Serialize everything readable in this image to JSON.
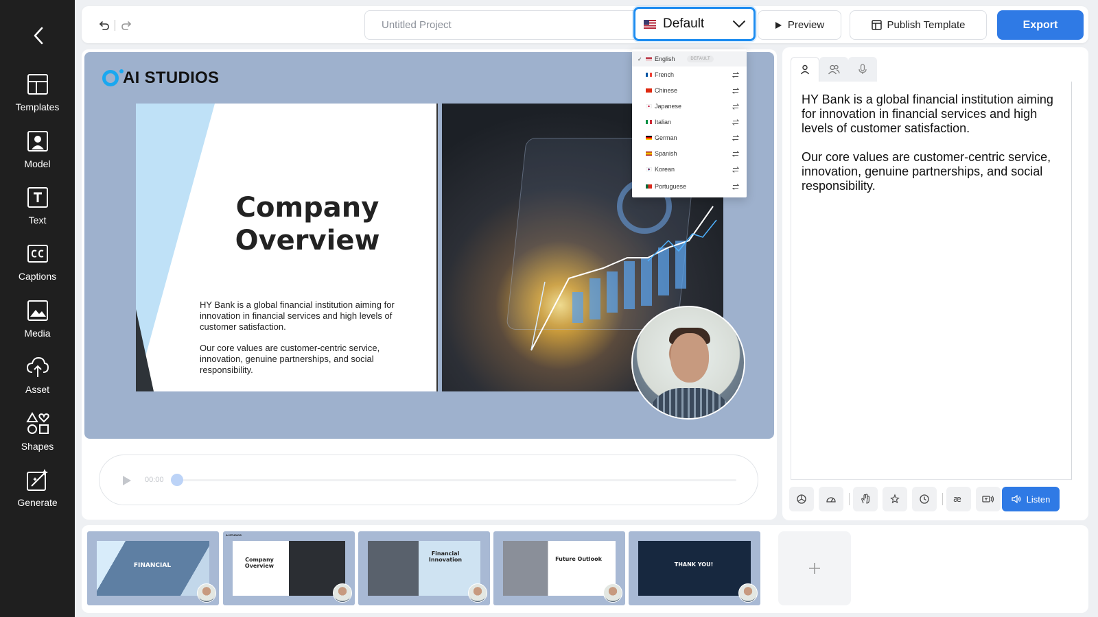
{
  "sidebar": {
    "items": [
      {
        "label": "Templates"
      },
      {
        "label": "Model"
      },
      {
        "label": "Text"
      },
      {
        "label": "Captions"
      },
      {
        "label": "Media"
      },
      {
        "label": "Asset"
      },
      {
        "label": "Shapes"
      },
      {
        "label": "Generate"
      }
    ]
  },
  "topbar": {
    "project_placeholder": "Untitled Project",
    "language_selected": "Default",
    "preview_label": "Preview",
    "publish_label": "Publish Template",
    "export_label": "Export"
  },
  "language_menu": {
    "options": [
      {
        "label": "English",
        "badge": "DEFAULT",
        "selected": true
      },
      {
        "label": "French"
      },
      {
        "label": "Chinese"
      },
      {
        "label": "Japanese"
      },
      {
        "label": "Italian"
      },
      {
        "label": "German"
      },
      {
        "label": "Spanish"
      },
      {
        "label": "Korean"
      },
      {
        "label": "Portuguese"
      }
    ]
  },
  "slide": {
    "logo_text": "AI STUDIOS",
    "title_line1": "Company",
    "title_line2": "Overview",
    "body_p1": "HY Bank is a global financial institution aiming for innovation in financial services and high levels of customer satisfaction.",
    "body_p2": "Our core values are customer-centric service, innovation, genuine partnerships, and social responsibility."
  },
  "player": {
    "time": "00:00",
    "progress": 0
  },
  "script": {
    "p1": "HY Bank is a global financial institution aiming for innovation in financial services and high levels of customer satisfaction.",
    "p2": "Our core values are customer-centric service, innovation, genuine partnerships, and social responsibility.",
    "listen_label": "Listen"
  },
  "scenes": [
    {
      "title": "FINANCIAL"
    },
    {
      "title": "Company Overview"
    },
    {
      "title": "Financial Innovation"
    },
    {
      "title": "Future Outlook"
    },
    {
      "title": "THANK YOU!"
    }
  ],
  "colors": {
    "accent": "#2f7ae5",
    "focus": "#1d8cf0",
    "sidebar": "#1f1f1f",
    "slide_bg": "#9eb1cd"
  }
}
